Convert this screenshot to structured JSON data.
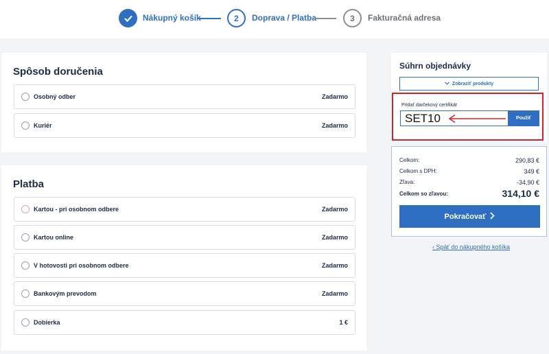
{
  "stepper": {
    "steps": [
      {
        "number": "",
        "label": "Nákupný košík"
      },
      {
        "number": "2",
        "label": "Doprava / Platba"
      },
      {
        "number": "3",
        "label": "Fakturačná adresa"
      }
    ]
  },
  "delivery": {
    "title": "Spôsob doručenia",
    "options": [
      {
        "label": "Osobný odber",
        "price": "Zadarmo"
      },
      {
        "label": "Kuriér",
        "price": "Zadarmo"
      }
    ]
  },
  "payment": {
    "title": "Platba",
    "options": [
      {
        "label": "Kartou - pri osobnom odbere",
        "price": "Zadarmo"
      },
      {
        "label": "Kartou online",
        "price": "Zadarmo"
      },
      {
        "label": "V hotovosti pri osobnom odbere",
        "price": "Zadarmo"
      },
      {
        "label": "Bankovým prevodom",
        "price": "Zadarmo"
      },
      {
        "label": "Dobierka",
        "price": "1 €"
      }
    ]
  },
  "summary": {
    "title": "Súhrn objednávky",
    "show_products": "Zobraziť produkty",
    "certificate_label": "Pridať darčekový certifikát",
    "certificate_value": "SET10",
    "apply_label": "Použiť"
  },
  "totals": {
    "rows": [
      {
        "label": "Celkom:",
        "value": "290,83 €"
      },
      {
        "label": "Celkom s DPH:",
        "value": "349 €"
      },
      {
        "label": "Zľava:",
        "value": "-34,90 €"
      }
    ],
    "total_label": "Celkom so zľavou:",
    "total_value": "314,10 €",
    "continue_label": "Pokračovať",
    "back_link": "Späť do nákupného košíka"
  },
  "colors": {
    "accent": "#2e6fc4",
    "highlight": "#d9202b"
  }
}
